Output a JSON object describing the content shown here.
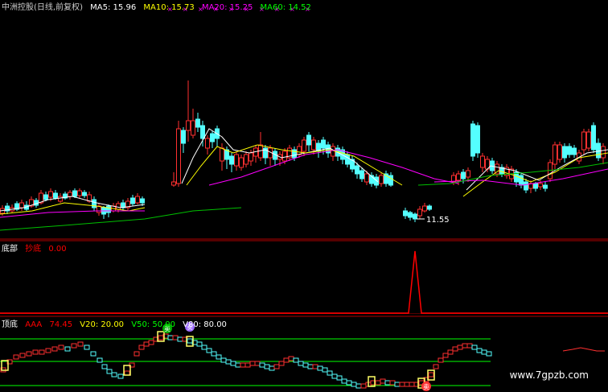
{
  "chart1": {
    "title": "中洲控股(日线,前复权)",
    "ma": [
      {
        "label": "MA5: 15.96",
        "color": "#ffffff"
      },
      {
        "label": "MA10: 15.73",
        "color": "#ffff00"
      },
      {
        "label": "MA20: 15.25",
        "color": "#ff00ff"
      },
      {
        "label": "MA60: 14.52",
        "color": "#00ff00"
      }
    ],
    "low_label": "11.55"
  },
  "chart2": {
    "name": "底部",
    "indicator_label": "抄底",
    "indicator_value": "0.00"
  },
  "chart3": {
    "name": "顶底",
    "aaa_label": "AAA",
    "aaa_value": "74.45",
    "v20_label": "V20: 20.00",
    "v50_label": "V50: 50.00",
    "v80_label": "V80: 80.00",
    "badges": [
      "卖",
      "卖",
      "卖"
    ]
  },
  "watermark": "www.7gpzb.com",
  "chart_data": {
    "type": "candlestick",
    "title": "中洲控股(日线,前复权)",
    "min_label": "11.55",
    "series": [
      {
        "name": "MA5",
        "value": 15.96
      },
      {
        "name": "MA10",
        "value": 15.73
      },
      {
        "name": "MA20",
        "value": 15.25
      },
      {
        "name": "MA60",
        "value": 14.52
      }
    ],
    "spike_value": "0.00",
    "aaa_value": "74.45"
  }
}
